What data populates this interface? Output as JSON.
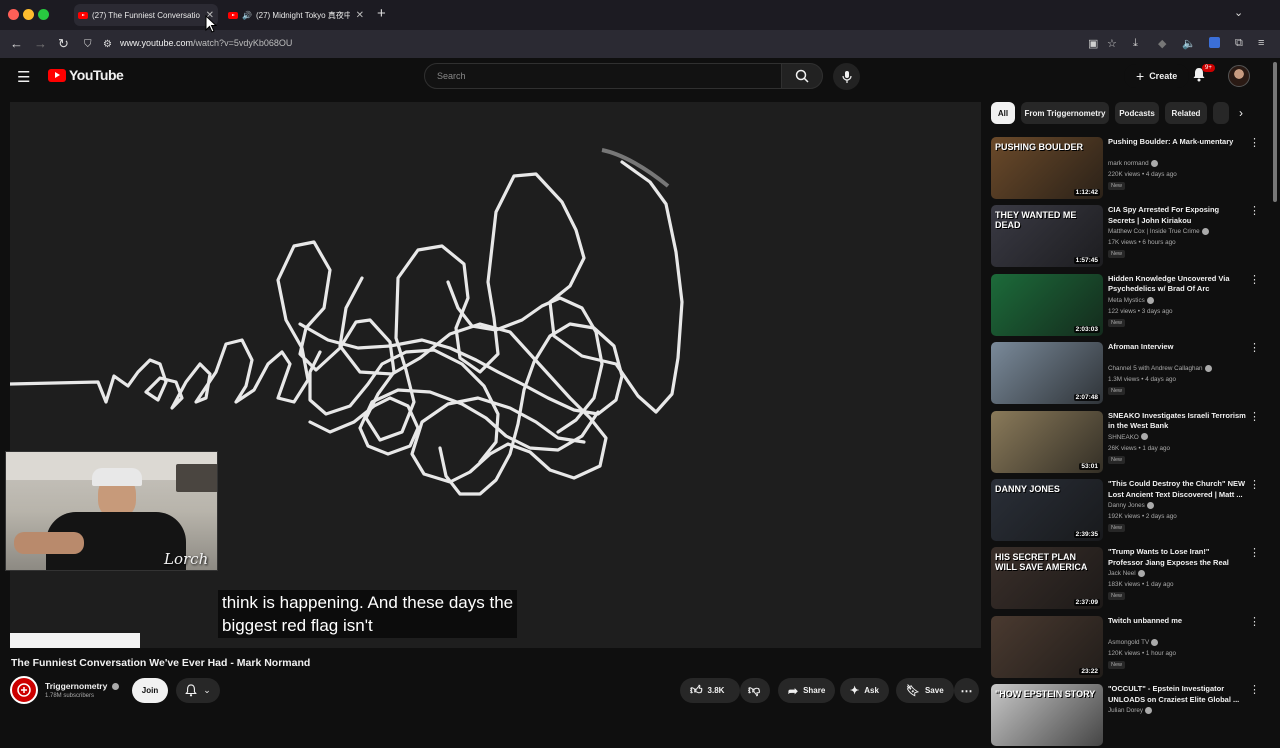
{
  "browser": {
    "tabs": [
      {
        "title": "(27) The Funniest Conversatio"
      },
      {
        "title": "(27) Midnight Tokyo 真夜中"
      }
    ],
    "new_tab": "+",
    "url_host": "www.youtube.com",
    "url_path": "/watch?v=5vdyKb068OU"
  },
  "masthead": {
    "logo_text": "YouTube",
    "search_placeholder": "Search",
    "create_label": "Create",
    "notification_badge": "9+"
  },
  "player": {
    "caption_line1": "think is happening. And these days the",
    "caption_line2": "biggest red flag isn't",
    "webcam_watermark": "Lorch"
  },
  "video": {
    "title": "The Funniest Conversation We've Ever Had - Mark Normand",
    "channel": "Triggernometry",
    "subscribers": "1.78M subscribers",
    "join_label": "Join",
    "likes": "3.8K",
    "share_label": "Share",
    "ask_label": "Ask",
    "save_label": "Save"
  },
  "chips": [
    "All",
    "From Triggernometry",
    "Podcasts",
    "Related"
  ],
  "recommendations": [
    {
      "title": "Pushing Boulder: A Mark-umentary",
      "channel": "mark normand",
      "views": "220K views • 4 days ago",
      "badge": "New",
      "duration": "1:12:42",
      "thumb_text": "PUSHING BOULDER",
      "color": "#6b4a2a"
    },
    {
      "title": "CIA Spy Arrested For Exposing Secrets | John Kiriakou",
      "channel": "Matthew Cox | Inside True Crime",
      "views": "17K views • 6 hours ago",
      "badge": "New",
      "duration": "1:57:45",
      "thumb_text": "THEY WANTED ME DEAD",
      "color": "#3a3a44"
    },
    {
      "title": "Hidden Knowledge Uncovered Via Psychedelics w/ Brad Of Arc",
      "channel": "Meta Mystics",
      "views": "122 views • 3 days ago",
      "badge": "New",
      "duration": "2:03:03",
      "thumb_text": "",
      "color": "#1c6b3a"
    },
    {
      "title": "Afroman Interview",
      "channel": "Channel 5 with Andrew Callaghan",
      "views": "1.3M views • 4 days ago",
      "badge": "New",
      "duration": "2:07:48",
      "thumb_text": "",
      "color": "#7a8a9a"
    },
    {
      "title": "SNEAKO Investigates Israeli Terrorism in the West Bank",
      "channel": "SHNEAKO",
      "views": "26K views • 1 day ago",
      "badge": "New",
      "duration": "53:01",
      "thumb_text": "",
      "color": "#8a7a5a"
    },
    {
      "title": "\"This Could Destroy the Church\" NEW Lost Ancient Text Discovered | Matt ...",
      "channel": "Danny Jones",
      "views": "192K views • 2 days ago",
      "badge": "New",
      "duration": "2:39:35",
      "thumb_text": "DANNY JONES",
      "color": "#2a2f38"
    },
    {
      "title": "\"Trump Wants to Lose Iran!\" Professor Jiang Exposes the Real Endgame | Jac...",
      "channel": "Jack Neel",
      "views": "183K views • 1 day ago",
      "badge": "New",
      "duration": "2:37:09",
      "thumb_text": "HIS SECRET PLAN WILL SAVE AMERICA",
      "color": "#3a2f2a"
    },
    {
      "title": "Twitch unbanned me",
      "channel": "Asmongold TV",
      "views": "120K views • 1 hour ago",
      "badge": "New",
      "duration": "23:22",
      "thumb_text": "",
      "color": "#4a3a30"
    },
    {
      "title": "\"OCCULT\" - Epstein Investigator UNLOADS on Craziest Elite Global ...",
      "channel": "Julian Dorey",
      "views": "",
      "badge": "",
      "duration": "",
      "thumb_text": "\"HOW EPSTEIN STORY",
      "color": "#c8c8c8"
    }
  ]
}
